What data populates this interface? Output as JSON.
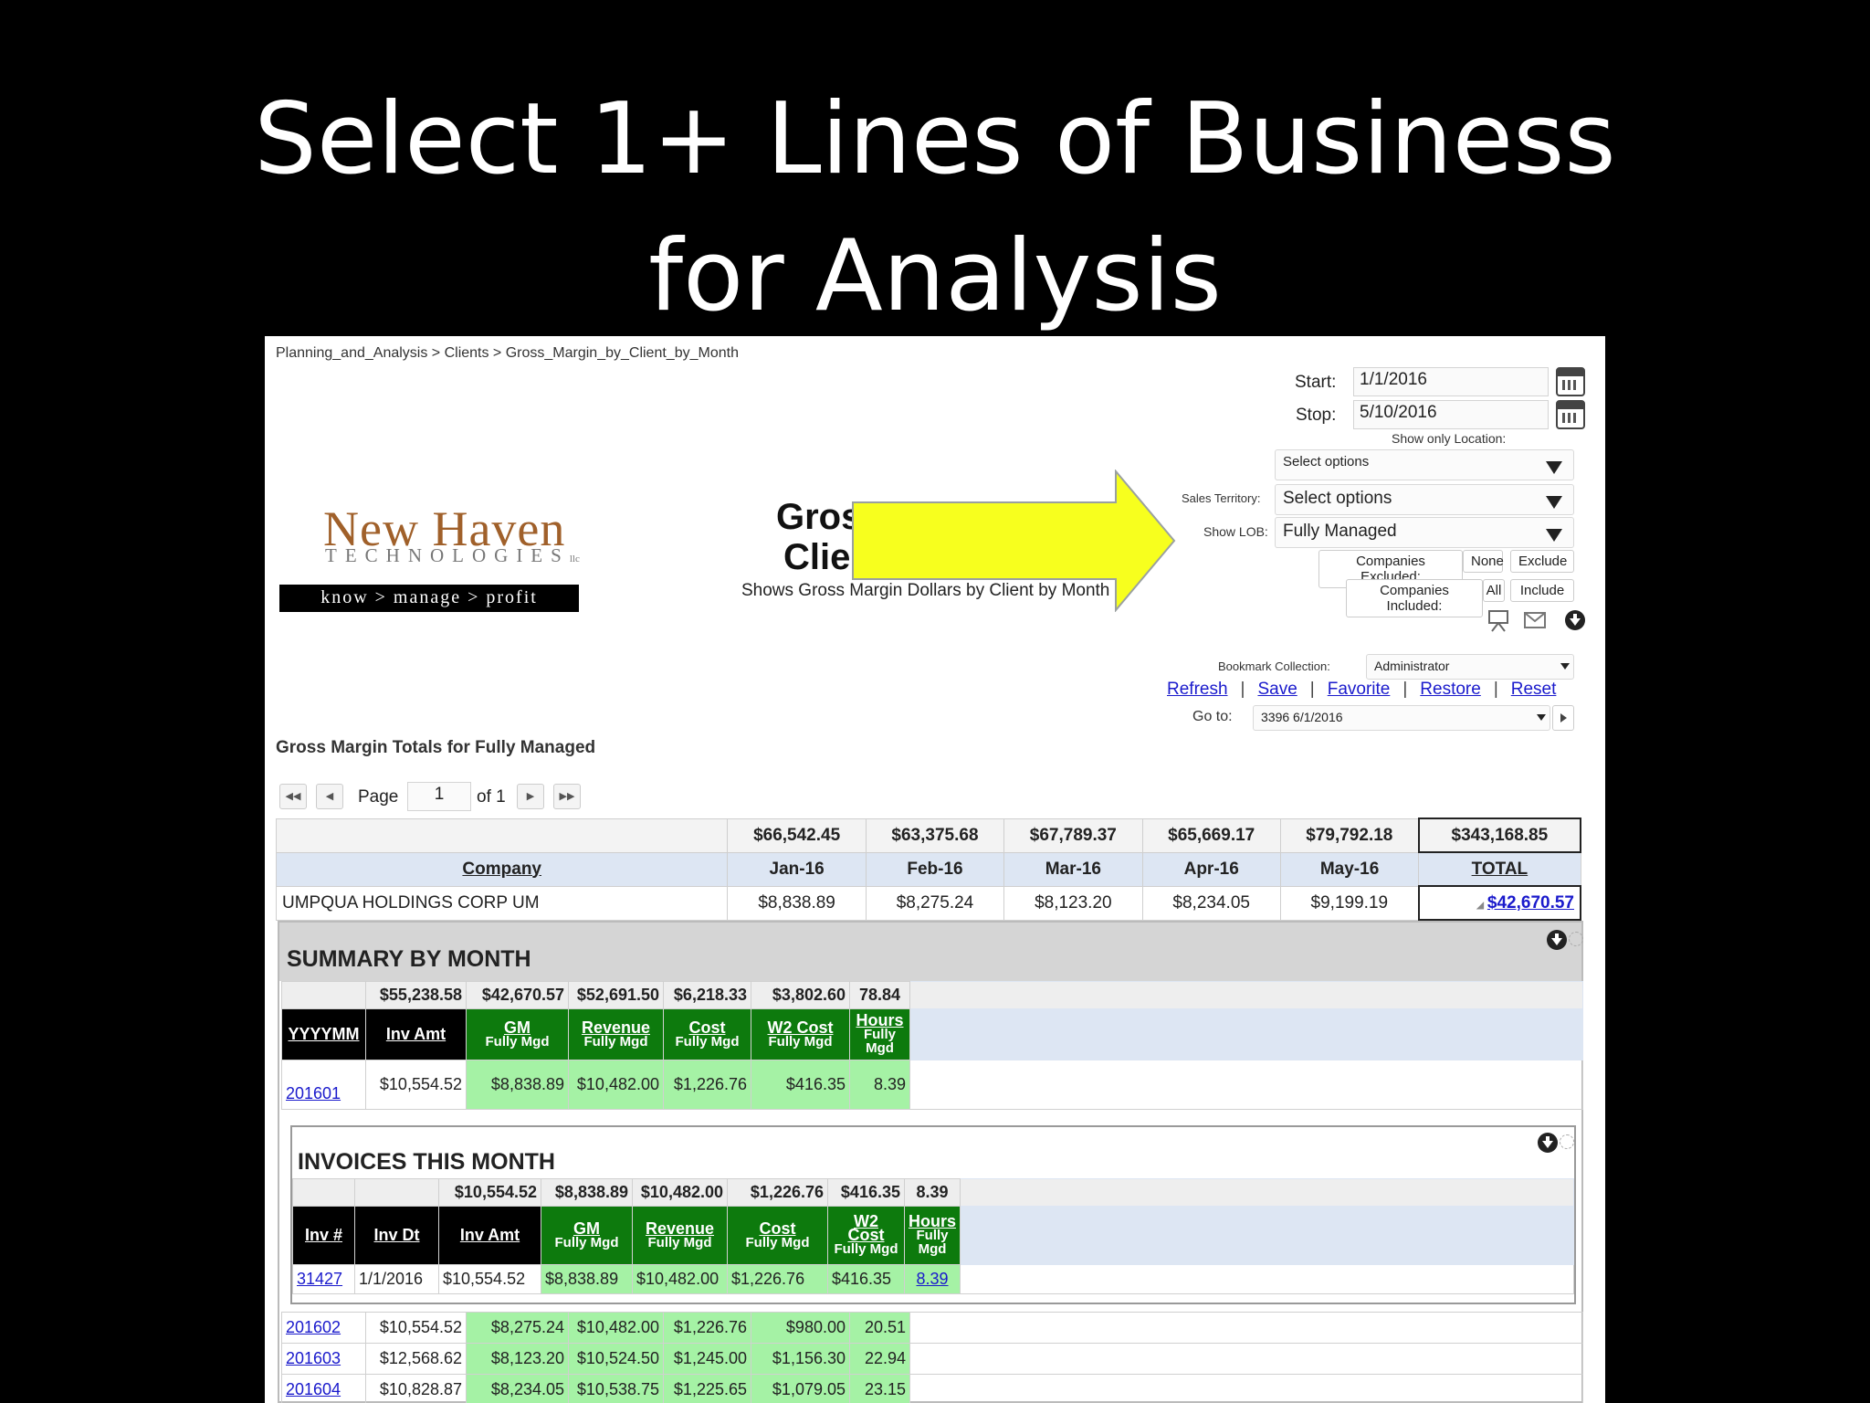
{
  "slide": {
    "title_line1": "Select 1+ Lines of Business",
    "title_line2": "for Analysis"
  },
  "breadcrumb": "Planning_and_Analysis > Clients > Gross_Margin_by_Client_by_Month",
  "filters": {
    "start_label": "Start:",
    "start_value": "1/1/2016",
    "stop_label": "Stop:",
    "stop_value": "5/10/2016",
    "location_label": "Show only Location:",
    "location_value": "Select options",
    "territory_label": "Sales Territory:",
    "territory_value": "Select options",
    "lob_label": "Show LOB:",
    "lob_value": "Fully Managed",
    "excluded_label": "Companies Excluded:",
    "excluded_value": "None",
    "exclude_btn": "Exclude",
    "included_label": "Companies Included:",
    "included_value": "All",
    "include_btn": "Include"
  },
  "logo": {
    "name": "New Haven",
    "sub": "TECHNOLOGIES",
    "llc": "llc",
    "tagline": "know > manage > profit"
  },
  "report": {
    "title_1": "Gros",
    "title_2": "Clie",
    "subtitle": "Shows Gross Margin Dollars by Client by Month"
  },
  "bookmarks": {
    "collection_label": "Bookmark Collection:",
    "collection_value": "Administrator",
    "refresh": "Refresh",
    "save": "Save",
    "favorite": "Favorite",
    "restore": "Restore",
    "reset": "Reset",
    "goto_label": "Go to:",
    "goto_value": "3396 6/1/2016"
  },
  "section_heading": "Gross Margin Totals for Fully Managed",
  "pager": {
    "page_label": "Page",
    "page_value": "1",
    "of_label": "of 1"
  },
  "main_table": {
    "totals": [
      "$66,542.45",
      "$63,375.68",
      "$67,789.37",
      "$65,669.17",
      "$79,792.18",
      "$343,168.85"
    ],
    "headers": [
      "Company",
      "Jan-16",
      "Feb-16",
      "Mar-16",
      "Apr-16",
      "May-16",
      "TOTAL"
    ],
    "row": [
      "UMPQUA HOLDINGS CORP UM",
      "$8,838.89",
      "$8,275.24",
      "$8,123.20",
      "$8,234.05",
      "$9,199.19",
      "$42,670.57"
    ]
  },
  "summary": {
    "title": "SUMMARY BY MONTH",
    "totals": [
      "$55,238.58",
      "$42,670.57",
      "$52,691.50",
      "$6,218.33",
      "$3,802.60",
      "78.84"
    ],
    "headers": {
      "h1": "YYYYMM",
      "h2": "Inv Amt",
      "h3a": "GM",
      "h3b": "Fully Mgd",
      "h4a": "Revenue",
      "h4b": "Fully Mgd",
      "h5a": "Cost",
      "h5b": "Fully Mgd",
      "h6a": "W2 Cost",
      "h6b": "Fully Mgd",
      "h7a": "Hours",
      "h7b": "Fully",
      "h7c": "Mgd"
    },
    "first_row": [
      "201601",
      "$10,554.52",
      "$8,838.89",
      "$10,482.00",
      "$1,226.76",
      "$416.35",
      "8.39"
    ],
    "rows": [
      [
        "201602",
        "$10,554.52",
        "$8,275.24",
        "$10,482.00",
        "$1,226.76",
        "$980.00",
        "20.51"
      ],
      [
        "201603",
        "$12,568.62",
        "$8,123.20",
        "$10,524.50",
        "$1,245.00",
        "$1,156.30",
        "22.94"
      ],
      [
        "201604",
        "$10,828.87",
        "$8,234.05",
        "$10,538.75",
        "$1,225.65",
        "$1,079.05",
        "23.15"
      ]
    ]
  },
  "invoices": {
    "title": "INVOICES THIS MONTH",
    "totals": [
      "$10,554.52",
      "$8,838.89",
      "$10,482.00",
      "$1,226.76",
      "$416.35",
      "8.39"
    ],
    "headers": {
      "h1": "Inv #",
      "h2": "Inv Dt",
      "h3": "Inv Amt",
      "h4a": "GM",
      "h4b": "Fully Mgd",
      "h5a": "Revenue",
      "h5b": "Fully Mgd",
      "h6a": "Cost",
      "h6b": "Fully Mgd",
      "h7a": "W2",
      "h7b": "Cost",
      "h7c": "Fully Mgd",
      "h8a": "Hours",
      "h8b": "Fully",
      "h8c": "Mgd"
    },
    "row": [
      "31427",
      "1/1/2016",
      "$10,554.52",
      "$8,838.89",
      "$10,482.00",
      "$1,226.76",
      "$416.35",
      "8.39"
    ]
  },
  "colors": {
    "arrow": "#f7ff1e",
    "header_green": "#0d7a0d",
    "cell_green": "#a5f2a5",
    "header_blue": "#dde6f3",
    "link": "#1a1acc",
    "logo_brown": "#a0602a"
  }
}
